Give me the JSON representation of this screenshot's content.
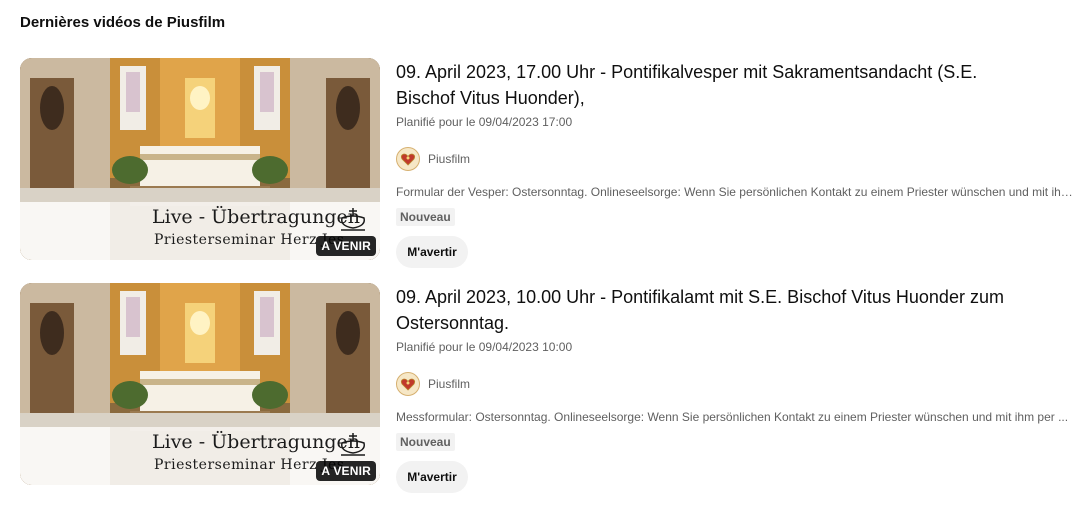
{
  "section": {
    "title": "Dernières vidéos de Piusfilm"
  },
  "colors": {
    "badge_bg": "#0f0f0f",
    "chip_bg": "#f2f2f2",
    "meta_text": "#606060"
  },
  "videos": [
    {
      "title": "09. April 2023, 17.00 Uhr - Pontifikalvesper mit Sakramentsandacht (S.E. Bischof Vitus Huonder),",
      "scheduled": "Planifié pour le 09/04/2023 17:00",
      "channel": "Piusfilm",
      "description": "Formular der Vesper: Ostersonntag. Onlineseelsorge: Wenn Sie persönlichen Kontakt zu einem Priester wünschen und mit ihm ...",
      "badge": "Nouveau",
      "notify_label": "M'avertir",
      "overlay_badge": "A VENIR",
      "thumbnail": {
        "line1": "Live - Übertragungen",
        "line2": "Priesterseminar Herz Jes",
        "icon": "chalice-emblem-icon"
      }
    },
    {
      "title": "09. April 2023, 10.00 Uhr - Pontifikalamt mit S.E. Bischof Vitus Huonder zum Ostersonntag.",
      "scheduled": "Planifié pour le 09/04/2023 10:00",
      "channel": "Piusfilm",
      "description": "Messformular: Ostersonntag. Onlineseelsorge: Wenn Sie persönlichen Kontakt zu einem Priester wünschen und mit ihm per ...",
      "badge": "Nouveau",
      "notify_label": "M'avertir",
      "overlay_badge": "A VENIR",
      "thumbnail": {
        "line1": "Live - Übertragungen",
        "line2": "Priesterseminar Herz Jes",
        "icon": "chalice-emblem-icon"
      }
    }
  ]
}
